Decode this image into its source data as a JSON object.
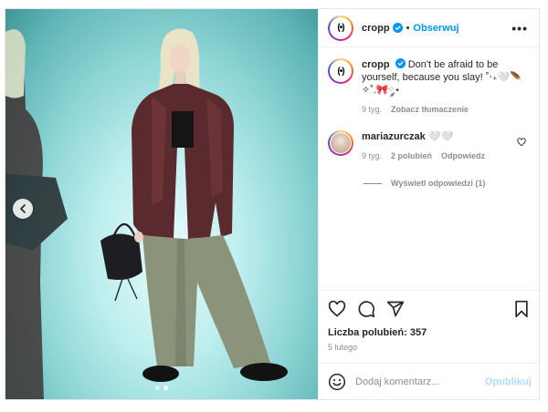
{
  "post": {
    "author": "cropp",
    "follow_label": "Obserwuj",
    "more_label": "•••",
    "separator": "•",
    "logo_text": "(•)"
  },
  "caption": {
    "user": "cropp",
    "text": "Don't be afraid to be yourself, because you slay! ˚‧₊🤍🪶✧˚.🎀༘⋆",
    "time": "9 tyg.",
    "translate_label": "Zobacz tłumaczenie"
  },
  "comments": [
    {
      "user": "mariazurczak",
      "text": "🤍🤍",
      "time": "9 tyg.",
      "likes_label": "2 polubień",
      "reply_label": "Odpowiedz",
      "view_replies_label": "Wyświetl odpowiedzi (1)"
    }
  ],
  "engagement": {
    "likes_label": "Liczba polubień: 357",
    "date": "5 lutego"
  },
  "composer": {
    "placeholder": "Dodaj komentarz...",
    "publish_label": "Opublikuj"
  },
  "carousel": {
    "slide_count": 2,
    "active_index": 1
  },
  "colors": {
    "accent": "#0095f6",
    "publish_disabled": "#b3dbff",
    "muted": "#8e8e8e",
    "text": "#262626"
  },
  "icons": [
    "chevron-left-icon",
    "verified-badge-icon",
    "more-icon",
    "heart-icon",
    "comment-icon",
    "share-icon",
    "bookmark-icon",
    "emoji-icon"
  ]
}
